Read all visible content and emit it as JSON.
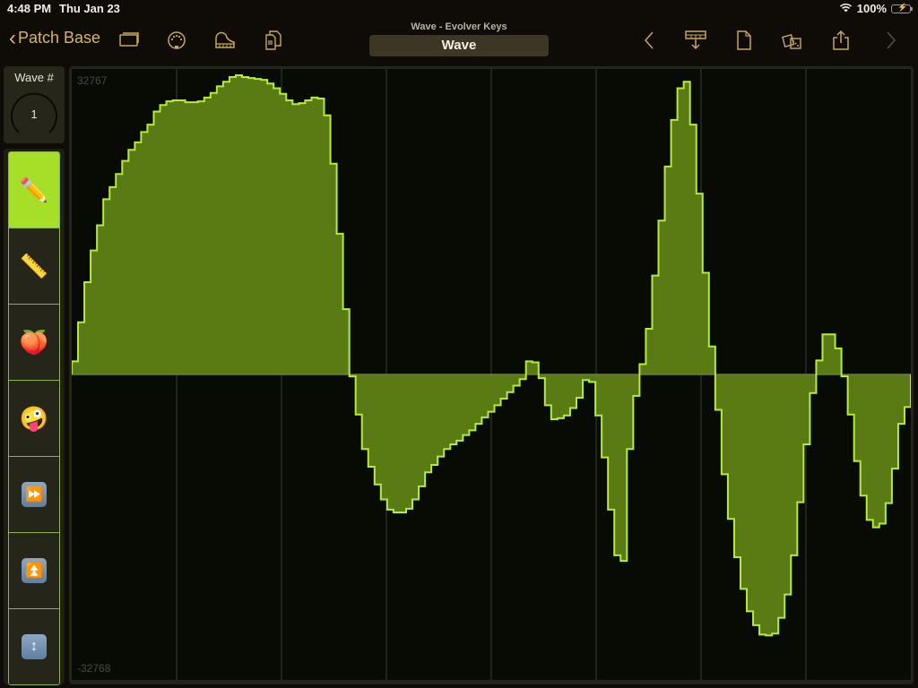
{
  "status_bar": {
    "time": "4:48 PM",
    "date": "Thu Jan 23",
    "battery": "100%",
    "icons": [
      "wifi-icon",
      "battery-charging-icon"
    ]
  },
  "nav": {
    "back_label": "Patch Base",
    "left_icons": [
      "windows-icon",
      "midi-port-icon",
      "piano-icon",
      "copy-document-icon"
    ],
    "subtitle": "Wave - Evolver Keys",
    "title": "Wave",
    "right_icons": [
      "previous-chevron-icon",
      "send-to-keyboard-icon",
      "new-document-icon",
      "randomize-dice-icon",
      "share-icon",
      "next-chevron-icon"
    ]
  },
  "wave_selector": {
    "label": "Wave #",
    "value": "1"
  },
  "tools": [
    {
      "name": "pencil",
      "glyph": "✏️",
      "selected": true
    },
    {
      "name": "ruler-line",
      "glyph": "📏",
      "selected": false
    },
    {
      "name": "peach-smooth",
      "glyph": "🍑",
      "selected": false
    },
    {
      "name": "zany-random",
      "glyph": "🤪",
      "selected": false
    },
    {
      "name": "fast-forward-shift",
      "glyph": "⏩",
      "selected": false
    },
    {
      "name": "scale-up",
      "glyph": "⏫",
      "selected": false
    },
    {
      "name": "normalize",
      "glyph": "↕",
      "selected": false
    }
  ],
  "colors": {
    "accent": "#a6df27",
    "wave_fill": "#5a7a14",
    "wave_stroke": "#b4ec3a",
    "nav_tint": "#d6b65a"
  },
  "chart_data": {
    "type": "bar",
    "title": "Wave",
    "ylim": [
      -32768,
      32767
    ],
    "max_label": "32767",
    "min_label": "-32768",
    "grid_vertical_divisions": 8,
    "sample_count": 128,
    "values": [
      1400,
      5600,
      9900,
      13300,
      16000,
      18800,
      20100,
      21500,
      22900,
      24100,
      24900,
      26000,
      26800,
      28200,
      28900,
      29300,
      29400,
      29400,
      29200,
      29200,
      29300,
      29700,
      30200,
      30900,
      31400,
      31900,
      32100,
      31900,
      31800,
      31700,
      31600,
      31200,
      30700,
      30100,
      29400,
      29000,
      29100,
      29400,
      29700,
      29600,
      27800,
      22600,
      15100,
      7000,
      -200,
      -4300,
      -8000,
      -9900,
      -11800,
      -13400,
      -14500,
      -14800,
      -14800,
      -14400,
      -13400,
      -12000,
      -10500,
      -9700,
      -8800,
      -8000,
      -7500,
      -7100,
      -6500,
      -6000,
      -5300,
      -4600,
      -4000,
      -3300,
      -2600,
      -1900,
      -1200,
      -500,
      1400,
      1300,
      -400,
      -3300,
      -4800,
      -4700,
      -4400,
      -3600,
      -2500,
      -600,
      -800,
      -4400,
      -8900,
      -14500,
      -19400,
      -20000,
      -8000,
      -2300,
      1100,
      4900,
      10600,
      16500,
      22300,
      27300,
      30700,
      31400,
      26800,
      19400,
      10900,
      3000,
      -3800,
      -10700,
      -15500,
      -19600,
      -23000,
      -25400,
      -26900,
      -27900,
      -28000,
      -27800,
      -26100,
      -23600,
      -19400,
      -13700,
      -7500,
      -2000,
      1500,
      4300,
      4300,
      2800,
      -200,
      -4300,
      -9300,
      -13000,
      -15600,
      -16400,
      -16000,
      -13800,
      -10100,
      -5300,
      -3500
    ]
  }
}
